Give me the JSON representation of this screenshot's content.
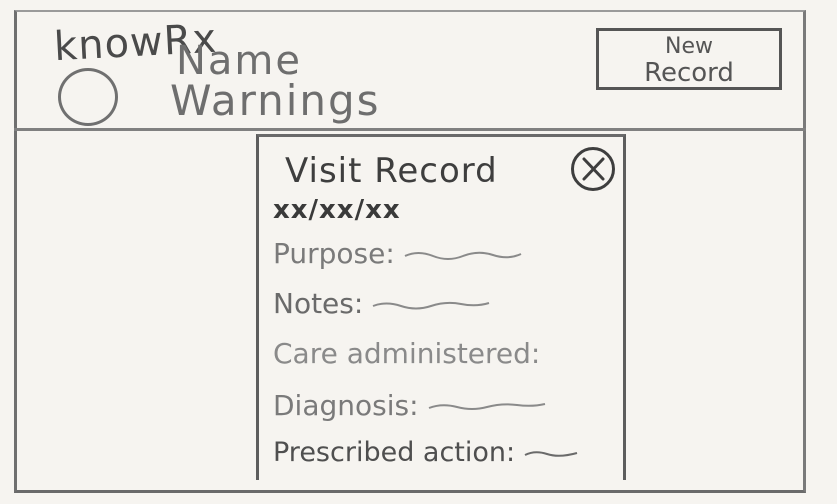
{
  "header": {
    "app_name": "knowRx",
    "patient_name": "Name",
    "patient_warnings": "Warnings",
    "new_record_line1": "New",
    "new_record_line2": "Record"
  },
  "modal": {
    "title": "Visit Record",
    "date": "xx/xx/xx",
    "fields": [
      {
        "label": "Purpose:"
      },
      {
        "label": "Notes:"
      },
      {
        "label": "Care administered:"
      },
      {
        "label": "Diagnosis:"
      },
      {
        "label": "Prescribed action:"
      }
    ]
  },
  "icons": {
    "avatar": "avatar-circle",
    "close": "close-x-circle-icon"
  }
}
